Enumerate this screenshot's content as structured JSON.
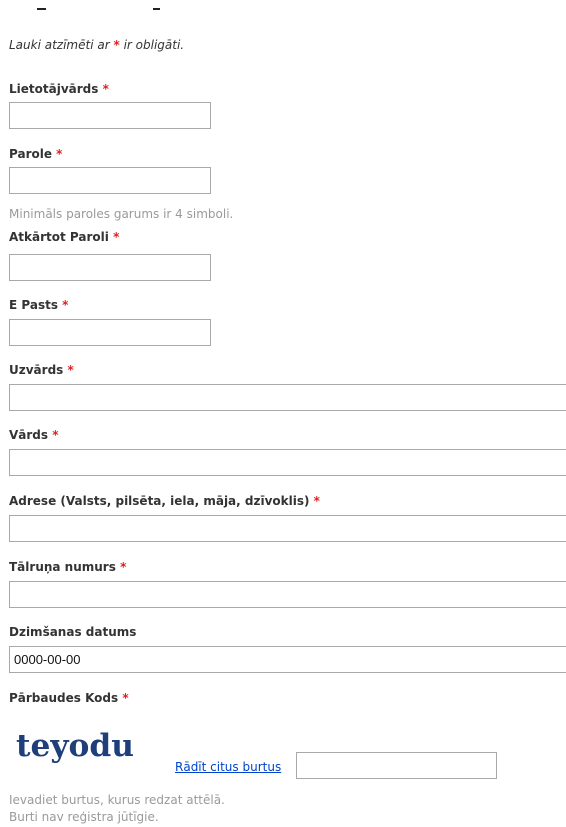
{
  "form": {
    "required_note_prefix": "Lauki atzīmēti ar ",
    "required_marker": "*",
    "required_note_suffix": " ir obligāti.",
    "fields": {
      "username": {
        "label": "Lietotājvārds",
        "value": ""
      },
      "password": {
        "label": "Parole",
        "value": ""
      },
      "password_hint": "Minimāls paroles garums ir 4 simboli.",
      "password_repeat": {
        "label": "Atkārtot Paroli",
        "value": ""
      },
      "email": {
        "label": "E Pasts",
        "value": ""
      },
      "surname": {
        "label": "Uzvārds",
        "value": ""
      },
      "first_name": {
        "label": "Vārds",
        "value": ""
      },
      "address": {
        "label": "Adrese (Valsts, pilsēta, iela, māja, dzīvoklis)",
        "value": ""
      },
      "phone": {
        "label": "Tālruņa numurs",
        "value": ""
      },
      "birth_date": {
        "label": "Dzimšanas datums",
        "value": "0000-00-00"
      },
      "captcha": {
        "label": "Pārbaudes Kods",
        "image_text": "teyodu",
        "refresh_link": "Rādīt citus burtus",
        "value": "",
        "hint_line1": "Ievadiet burtus, kurus redzat attēlā.",
        "hint_line2": "Burti nav reģistra jūtīgie."
      }
    }
  },
  "colors": {
    "required_star": "#e02020",
    "link": "#0044cc",
    "captcha_text": "#1f3f7a",
    "hint_text": "#9a9a9a",
    "input_border": "#a9a9a9"
  }
}
